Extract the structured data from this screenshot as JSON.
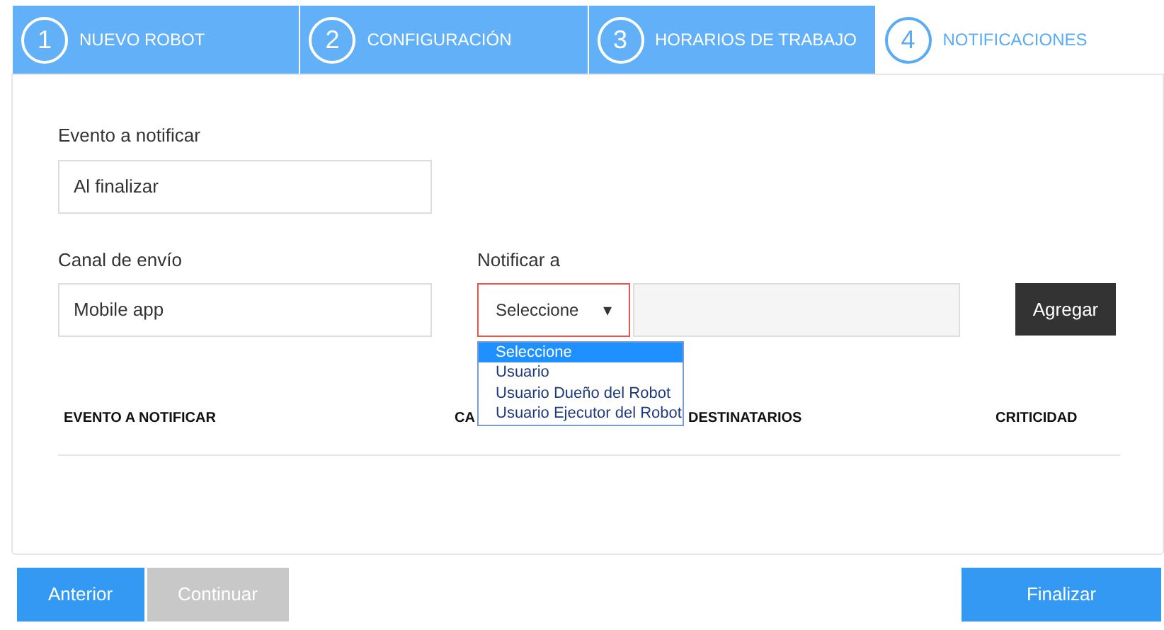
{
  "steps": [
    {
      "number": "1",
      "label": "NUEVO ROBOT",
      "selected": false
    },
    {
      "number": "2",
      "label": "CONFIGURACIÓN",
      "selected": false
    },
    {
      "number": "3",
      "label": "HORARIOS DE TRABAJO",
      "selected": false
    },
    {
      "number": "4",
      "label": "NOTIFICACIONES",
      "selected": true
    }
  ],
  "event_field": {
    "label": "Evento a notificar",
    "value": "Al finalizar"
  },
  "channel_field": {
    "label": "Canal de envío",
    "value": "Mobile app"
  },
  "notify_to": {
    "label": "Notificar a",
    "select_value": "Seleccione",
    "arrow": "▾",
    "options": [
      {
        "label": "Seleccione",
        "selected": true
      },
      {
        "label": "Usuario",
        "selected": false
      },
      {
        "label": "Usuario Dueño del Robot",
        "selected": false
      },
      {
        "label": "Usuario Ejecutor del Robot",
        "selected": false
      }
    ]
  },
  "add_button": "Agregar",
  "table": {
    "columns": [
      "EVENTO A NOTIFICAR",
      "CA",
      "DESTINATARIOS",
      "CRITICIDAD"
    ]
  },
  "buttons": [
    {
      "label": "Anterior",
      "disabled": false
    },
    {
      "label": "Continuar",
      "disabled": true
    }
  ],
  "finish_button": "Finalizar"
}
